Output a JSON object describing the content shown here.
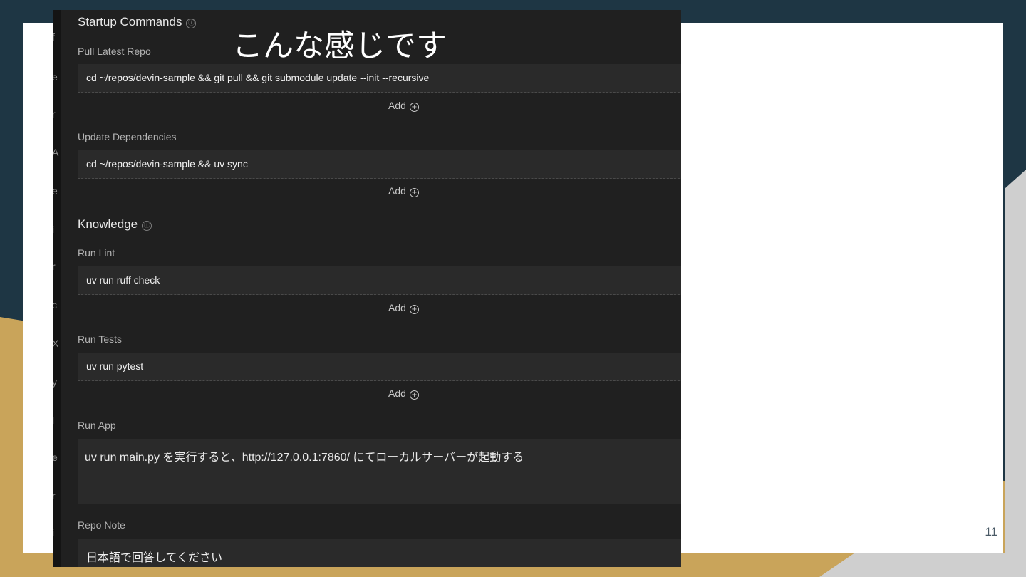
{
  "slide": {
    "title": "こんな感じです",
    "page_number": "11"
  },
  "startup": {
    "title": "Startup Commands",
    "info_icon": "ⓘ",
    "items": [
      {
        "label": "Pull Latest Repo",
        "command": "cd ~/repos/devin-sample && git pull && git submodule update --init --recursive",
        "add": "Add"
      },
      {
        "label": "Update Dependencies",
        "command": "cd ~/repos/devin-sample && uv sync",
        "add": "Add"
      }
    ]
  },
  "knowledge": {
    "title": "Knowledge",
    "info_icon": "ⓘ",
    "items": [
      {
        "label": "Run Lint",
        "command": "uv run ruff check",
        "add": "Add"
      },
      {
        "label": "Run Tests",
        "command": "uv run pytest",
        "add": "Add"
      },
      {
        "label": "Run App",
        "text": "uv run main.py を実行すると、http://127.0.0.1:7860/ にてローカルサーバーが起動する"
      },
      {
        "label": "Repo Note",
        "text": "日本語で回答してください"
      }
    ]
  },
  "add_icon": "+",
  "gutter_chars": [
    "f",
    "e",
    "r",
    "A",
    "e",
    "i",
    "r",
    "c",
    "X",
    "y",
    "l",
    "e",
    "r",
    "i"
  ],
  "colors": {
    "dark_bg": "#1e3644",
    "gold": "#c9a45a",
    "panel": "#202020",
    "field": "#2a2a2a"
  }
}
